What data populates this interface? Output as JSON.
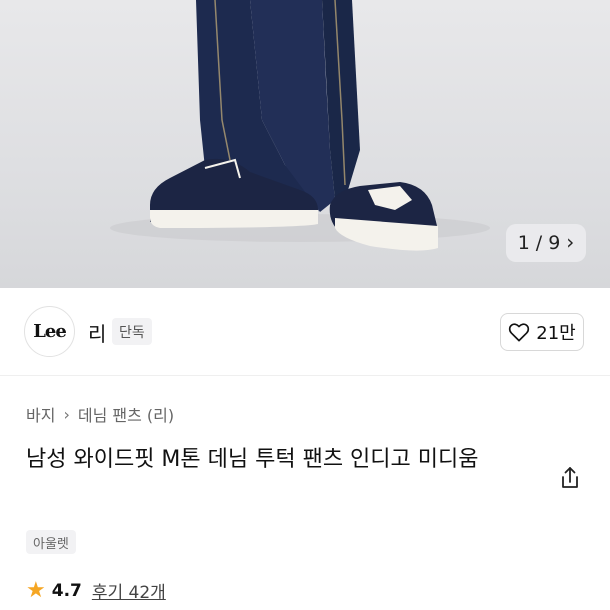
{
  "gallery": {
    "counter_current": "1",
    "counter_sep": "/",
    "counter_total": "9",
    "next_icon": "chevron-right-icon"
  },
  "brand": {
    "logo_text": "Lee",
    "name": "리",
    "exclusive_badge": "단독"
  },
  "like": {
    "icon": "heart-outline-icon",
    "count": "21만"
  },
  "breadcrumb": {
    "level1": "바지",
    "separator_icon": "chevron-right-icon",
    "level2": "데님 팬츠 (리)"
  },
  "product": {
    "title": "남성 와이드핏 M톤 데님 투턱 팬츠 인디고 미디움",
    "share_icon": "share-icon",
    "tag": "아울렛"
  },
  "rating": {
    "star_icon": "star-icon",
    "score": "4.7",
    "reviews": "후기 42개"
  },
  "colors": {
    "star": "#f5a623",
    "denim": "#1d2a4f",
    "background": "#ffffff"
  }
}
